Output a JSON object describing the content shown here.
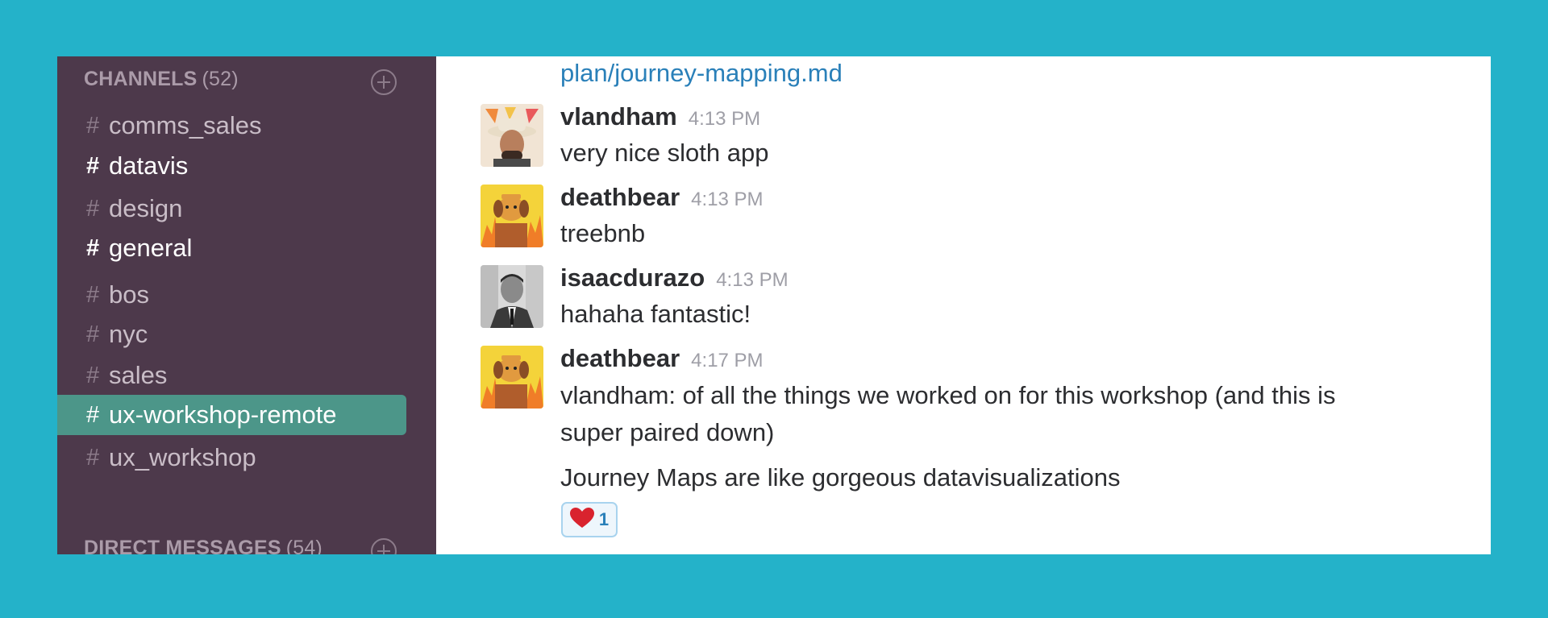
{
  "sidebar": {
    "channels_header": {
      "label": "CHANNELS",
      "count": "(52)"
    },
    "channels": [
      {
        "name": "comms_sales",
        "state": "normal"
      },
      {
        "name": "datavis",
        "state": "unread"
      },
      {
        "name": "design",
        "state": "normal"
      },
      {
        "name": "general",
        "state": "unread"
      },
      {
        "name": "bos",
        "state": "normal"
      },
      {
        "name": "nyc",
        "state": "normal"
      },
      {
        "name": "sales",
        "state": "normal"
      },
      {
        "name": "ux-workshop-remote",
        "state": "active"
      },
      {
        "name": "ux_workshop",
        "state": "normal"
      }
    ],
    "hash_symbol": "#",
    "dm_header": {
      "label": "DIRECT MESSAGES",
      "count": "(54)"
    }
  },
  "messages": {
    "link_text": "plan/journey-mapping.md",
    "items": [
      {
        "user": "vlandham",
        "time": "4:13 PM",
        "lines": [
          "very nice sloth app"
        ]
      },
      {
        "user": "deathbear",
        "time": "4:13 PM",
        "lines": [
          "treebnb"
        ]
      },
      {
        "user": "isaacdurazo",
        "time": "4:13 PM",
        "lines": [
          "hahaha fantastic!"
        ]
      },
      {
        "user": "deathbear",
        "time": "4:17 PM",
        "lines": [
          "vlandham:  of all the things we worked on for this workshop (and this is",
          "super paired down)",
          "Journey Maps are like gorgeous datavisualizations"
        ]
      }
    ],
    "reaction": {
      "emoji": "heart-icon",
      "count": "1"
    }
  },
  "colors": {
    "background": "#24b2c9",
    "sidebar": "#4d394b",
    "active_channel": "#4c9689",
    "link": "#2a80b9"
  }
}
